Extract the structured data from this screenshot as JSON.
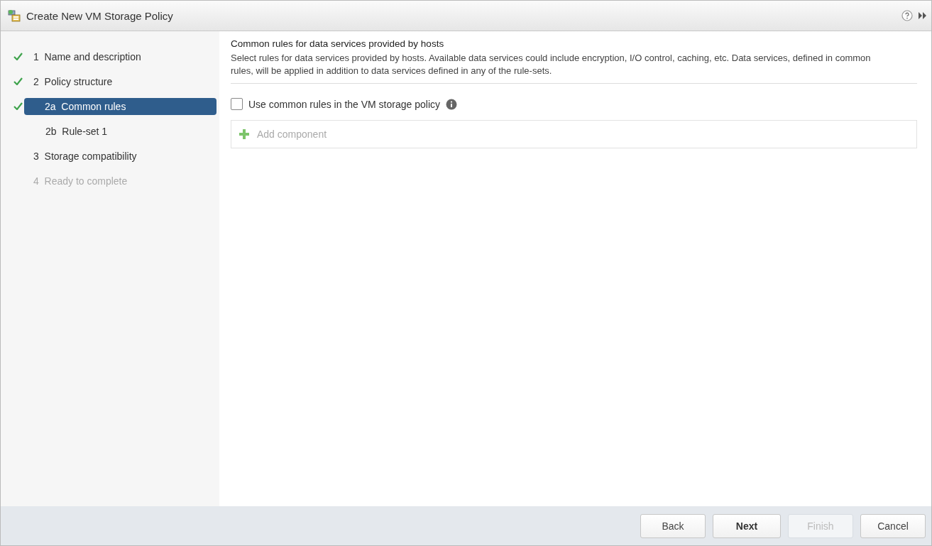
{
  "window": {
    "title": "Create New VM Storage Policy"
  },
  "steps": [
    {
      "label": "1  Name and description",
      "done": true,
      "selected": false,
      "disabled": false
    },
    {
      "label": "2  Policy structure",
      "done": true,
      "selected": false,
      "disabled": false,
      "children": [
        {
          "label": "2a  Common rules",
          "done": true,
          "selected": true,
          "disabled": false
        },
        {
          "label": "2b  Rule-set 1",
          "done": false,
          "selected": false,
          "disabled": false
        }
      ]
    },
    {
      "label": "3  Storage compatibility",
      "done": false,
      "selected": false,
      "disabled": false
    },
    {
      "label": "4  Ready to complete",
      "done": false,
      "selected": false,
      "disabled": true
    }
  ],
  "content": {
    "heading": "Common rules for data services provided by hosts",
    "description": "Select rules for data services provided by hosts. Available data services could include encryption, I/O control, caching, etc. Data services, defined in common rules, will be applied in addition to data services defined in any of the rule-sets.",
    "checkbox": {
      "label": "Use common rules in the VM storage policy",
      "checked": false
    },
    "add_component": {
      "label": "Add component",
      "disabled": true
    }
  },
  "buttons": [
    {
      "label": "Back",
      "kind": "default",
      "disabled": false
    },
    {
      "label": "Next",
      "kind": "primary",
      "disabled": false
    },
    {
      "label": "Finish",
      "kind": "default",
      "disabled": true
    },
    {
      "label": "Cancel",
      "kind": "default",
      "disabled": false
    }
  ]
}
